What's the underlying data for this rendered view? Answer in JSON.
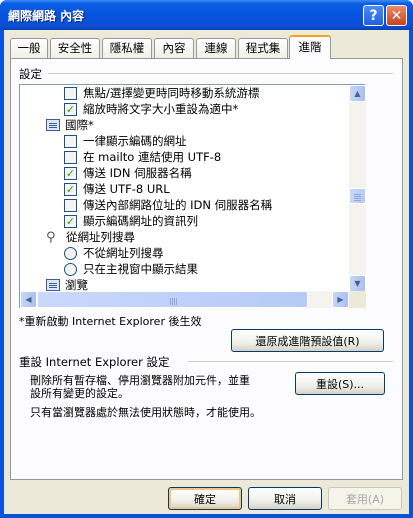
{
  "window": {
    "title": "網際網路 內容",
    "help_glyph": "?",
    "close_glyph": "✕"
  },
  "tabs": [
    {
      "label": "一般",
      "active": false
    },
    {
      "label": "安全性",
      "active": false
    },
    {
      "label": "隱私權",
      "active": false
    },
    {
      "label": "內容",
      "active": false
    },
    {
      "label": "連線",
      "active": false
    },
    {
      "label": "程式集",
      "active": false
    },
    {
      "label": "進階",
      "active": true
    }
  ],
  "settings": {
    "group_label": "設定",
    "items": [
      {
        "kind": "checkbox",
        "checked": false,
        "label": "焦點/選擇變更時同時移動系統游標"
      },
      {
        "kind": "checkbox",
        "checked": true,
        "label": "縮放時將文字大小重設為適中*"
      },
      {
        "kind": "category",
        "icon": "list-icon",
        "label": "國際*"
      },
      {
        "kind": "checkbox",
        "checked": false,
        "label": "一律顯示編碼的網址"
      },
      {
        "kind": "checkbox",
        "checked": false,
        "label": "在 mailto 連結使用 UTF-8"
      },
      {
        "kind": "checkbox",
        "checked": true,
        "label": "傳送 IDN 伺服器名稱"
      },
      {
        "kind": "checkbox",
        "checked": true,
        "label": "傳送 UTF-8 URL"
      },
      {
        "kind": "checkbox",
        "checked": false,
        "label": "傳送內部網路位址的 IDN 伺服器名稱"
      },
      {
        "kind": "checkbox",
        "checked": true,
        "label": "顯示編碼網址的資訊列"
      },
      {
        "kind": "category",
        "icon": "search-icon",
        "label": "從網址列搜尋"
      },
      {
        "kind": "radio",
        "checked": false,
        "label": "不從網址列搜尋"
      },
      {
        "kind": "radio",
        "checked": false,
        "label": "只在主視窗中顯示結果"
      },
      {
        "kind": "category",
        "icon": "list-icon",
        "label": "瀏覽"
      }
    ],
    "restart_note": "*重新啟動 Internet Explorer 後生效",
    "restore_button": "還原成進階預設值(R)"
  },
  "reset": {
    "group_label": "重設 Internet Explorer 設定",
    "description_line1": "刪除所有暫存檔、停用瀏覽器附加元件，並重",
    "description_line2": "設所有變更的設定。",
    "button": "重設(S)...",
    "footnote": "只有當瀏覽器處於無法使用狀態時，才能使用。"
  },
  "footer": {
    "ok": "確定",
    "cancel": "取消",
    "apply": "套用(A)"
  },
  "scrollbars": {
    "vertical": {
      "position_fraction": 0.55,
      "thumb_fraction": 0.09
    },
    "horizontal": {
      "position_fraction": 0.0,
      "thumb_fraction": 0.92
    }
  },
  "colors": {
    "title_bar": "#0a5ee5",
    "active_tab_highlight": "#f6a11c",
    "check_mark": "#21a121",
    "dialog_face": "#ece9d8"
  }
}
